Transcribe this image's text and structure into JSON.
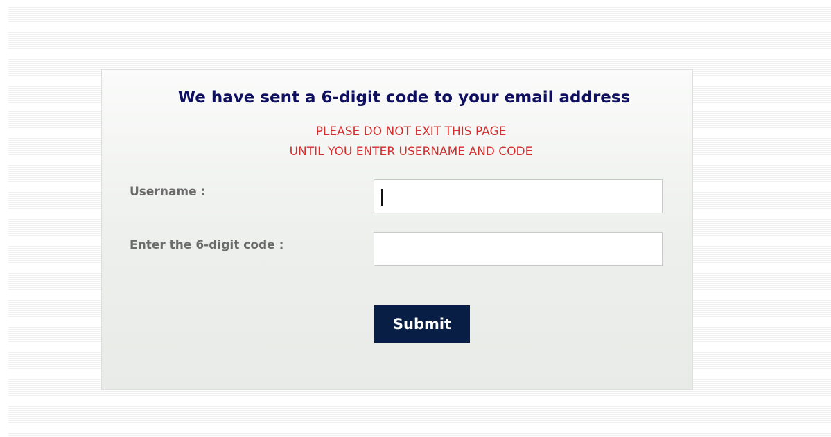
{
  "page": {
    "background_color": "#ffffff",
    "line_color": "#f0f0f0"
  },
  "form": {
    "heading": "We have sent a 6-digit code to your email address",
    "heading_color": "#0e0f5e",
    "warning_line1": "PLEASE DO NOT EXIT THIS PAGE",
    "warning_line2": "UNTIL YOU ENTER USERNAME AND CODE",
    "warning_color": "#d32f2f",
    "username_label": "Username :",
    "username_value": "",
    "username_placeholder": "",
    "code_label": "Enter the 6-digit code :",
    "code_value": "",
    "code_placeholder": "",
    "submit_label": "Submit",
    "submit_color": "#081e45"
  }
}
